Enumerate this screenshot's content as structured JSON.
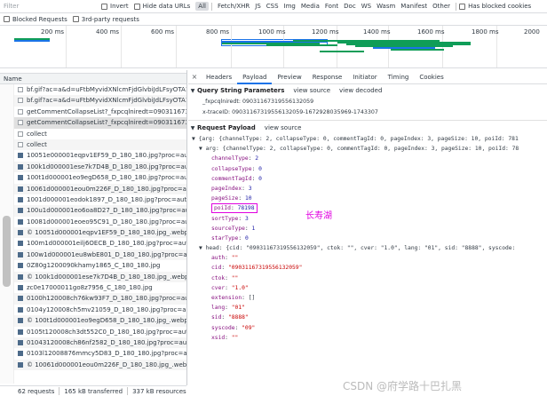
{
  "filterbar": {
    "filter_placeholder": "Filter",
    "invert_label": "Invert",
    "hide_data_urls_label": "Hide data URLs",
    "types": [
      "All",
      "Fetch/XHR",
      "JS",
      "CSS",
      "Img",
      "Media",
      "Font",
      "Doc",
      "WS",
      "Wasm",
      "Manifest",
      "Other"
    ],
    "active_type": "All",
    "has_blocked_cookies_label": "Has blocked cookies"
  },
  "filterbar2": {
    "blocked_requests_label": "Blocked Requests",
    "third_party_label": "3rd-party requests"
  },
  "overview": {
    "ticks": [
      "200 ms",
      "400 ms",
      "600 ms",
      "800 ms",
      "1000 ms",
      "1200 ms",
      "1400 ms",
      "1600 ms",
      "1800 ms",
      "2000"
    ]
  },
  "list": {
    "header": "Name",
    "rows": [
      {
        "name": "bf.gif?ac=a&d=uFtbMyvidXNlcmFjdGlvbiJdLFsyOTA1",
        "icon": "doc"
      },
      {
        "name": "bf.gif?ac=a&d=uFtbMyvidXNlcmFjdGlvbiJdLFsyOTA1",
        "icon": "doc"
      },
      {
        "name": "getCommentCollapseList?_fxpcqlniredt=0903116731",
        "icon": "doc"
      },
      {
        "name": "getCommentCollapseList?_fxpcqlniredt=0903116731",
        "icon": "doc",
        "selected": true
      },
      {
        "name": "collect",
        "icon": "doc"
      },
      {
        "name": "collect",
        "icon": "doc"
      },
      {
        "name": "10051e000001eqpv1EF59_D_180_180.jpg?proc=auto",
        "icon": "img"
      },
      {
        "name": "100k1d000001ese7k7D4B_D_180_180.jpg?proc=auto",
        "icon": "img"
      },
      {
        "name": "100t1d000001eo9egD658_D_180_180.jpg?proc=auto",
        "icon": "img"
      },
      {
        "name": "10061d000001eou0m226F_D_180_180.jpg?proc=auto",
        "icon": "img"
      },
      {
        "name": "1001d000001eodok1897_D_180_180.jpg?proc=auto",
        "icon": "img"
      },
      {
        "name": "100u1d000001eo6oa8D27_D_180_180.jpg?proc=auto",
        "icon": "img"
      },
      {
        "name": "10081d000001eoeo95C91_D_180_180.jpg?proc=auto",
        "icon": "img"
      },
      {
        "name": "© 10051d000001eqpv1EF59_D_180_180.jpg_.webp?p",
        "icon": "img"
      },
      {
        "name": "100m1d000001eilj6OECB_D_180_180.jpg?proc=auto",
        "icon": "img"
      },
      {
        "name": "100w1d000001eu8wbE801_D_180_180.jpg?proc=auto",
        "icon": "img"
      },
      {
        "name": "0Z80g1200090khamy1865_C_180_180.jpg",
        "icon": "img"
      },
      {
        "name": "© 100k1d000001ese7k7D4B_D_180_180.jpg_.webp?p",
        "icon": "img"
      },
      {
        "name": "zc0e17000011go8z7956_C_180_180.jpg",
        "icon": "img"
      },
      {
        "name": "0100h120008ch76kw93F7_D_180_180.jpg?proc=auto",
        "icon": "img"
      },
      {
        "name": "0104y120008ch5mv21059_D_180_180.jpg?proc=auto",
        "icon": "img"
      },
      {
        "name": "© 100t1d000001eo9egD658_D_180_180.jpg_.webp?p",
        "icon": "img"
      },
      {
        "name": "0105t120008ch3dt552C0_D_180_180.jpg?proc=auto",
        "icon": "img"
      },
      {
        "name": "01043120008ch86nf2582_D_180_180.jpg?proc=auto",
        "icon": "img"
      },
      {
        "name": "0103l12008876mmcy5D83_D_180_180.jpg?proc=auto",
        "icon": "img"
      },
      {
        "name": "© 10061d000001eou0m226F_D_180_180.jpg_.webp?...",
        "icon": "img"
      }
    ]
  },
  "statusbar": {
    "requests": "62 requests",
    "transferred": "165 kB transferred",
    "resources": "337 kB resources"
  },
  "tabs": {
    "close": "×",
    "items": [
      "Headers",
      "Payload",
      "Preview",
      "Response",
      "Initiator",
      "Timing",
      "Cookies"
    ],
    "active": "Payload"
  },
  "payload": {
    "qsp": {
      "title": "Query String Parameters",
      "view_source": "view source",
      "view_decoded": "view decoded",
      "params": [
        {
          "key": "_fxpcqlniredt:",
          "value": "09031167319556132059"
        },
        {
          "key": "x-traceID:",
          "value": "09031167319556132059-1672928035969-1743307"
        }
      ]
    },
    "rp": {
      "title": "Request Payload",
      "view_source": "view source",
      "summary": "{arg: {channelType: 2, collapseType: 0, commentTagId: 0, pageIndex: 3, pageSize: 10, poiId: 781",
      "arg_summary": "arg: {channelType: 2, collapseType: 0, commentTagId: 0, pageIndex: 3, pageSize: 10, poiId: 78",
      "arg_fields": [
        {
          "k": "channelType",
          "v": "2",
          "t": "num"
        },
        {
          "k": "collapseType",
          "v": "0",
          "t": "num"
        },
        {
          "k": "commentTagId",
          "v": "0",
          "t": "num"
        },
        {
          "k": "pageIndex",
          "v": "3",
          "t": "num"
        },
        {
          "k": "pageSize",
          "v": "10",
          "t": "num"
        }
      ],
      "poi_field": {
        "k": "poiId",
        "v": "78198"
      },
      "arg_fields_after": [
        {
          "k": "sortType",
          "v": "3",
          "t": "num"
        },
        {
          "k": "sourceType",
          "v": "1",
          "t": "num"
        },
        {
          "k": "starType",
          "v": "0",
          "t": "num"
        }
      ],
      "head_summary": "head: {cid: \"09031167319556132059\", ctok: \"\", cver: \"1.0\", lang: \"01\", sid: \"8888\", syscode:",
      "head_fields": [
        {
          "k": "auth",
          "v": "\"\"",
          "t": "str"
        },
        {
          "k": "cid",
          "v": "\"09031167319556132059\"",
          "t": "str"
        },
        {
          "k": "ctok",
          "v": "\"\"",
          "t": "str"
        },
        {
          "k": "cver",
          "v": "\"1.0\"",
          "t": "str"
        },
        {
          "k": "extension",
          "v": "[]",
          "t": "plain"
        },
        {
          "k": "lang",
          "v": "\"01\"",
          "t": "str"
        },
        {
          "k": "sid",
          "v": "\"8888\"",
          "t": "str"
        },
        {
          "k": "syscode",
          "v": "\"09\"",
          "t": "str"
        },
        {
          "k": "xsid",
          "v": "\"\"",
          "t": "str"
        }
      ]
    },
    "annotation": "长寿湖"
  },
  "watermark": "CSDN @府学路十巴扎黑",
  "colors": {
    "accent": "#1a73e8",
    "key": "#881280",
    "number": "#1a1aa6",
    "string": "#c80000",
    "highlight": "#e000e0"
  }
}
